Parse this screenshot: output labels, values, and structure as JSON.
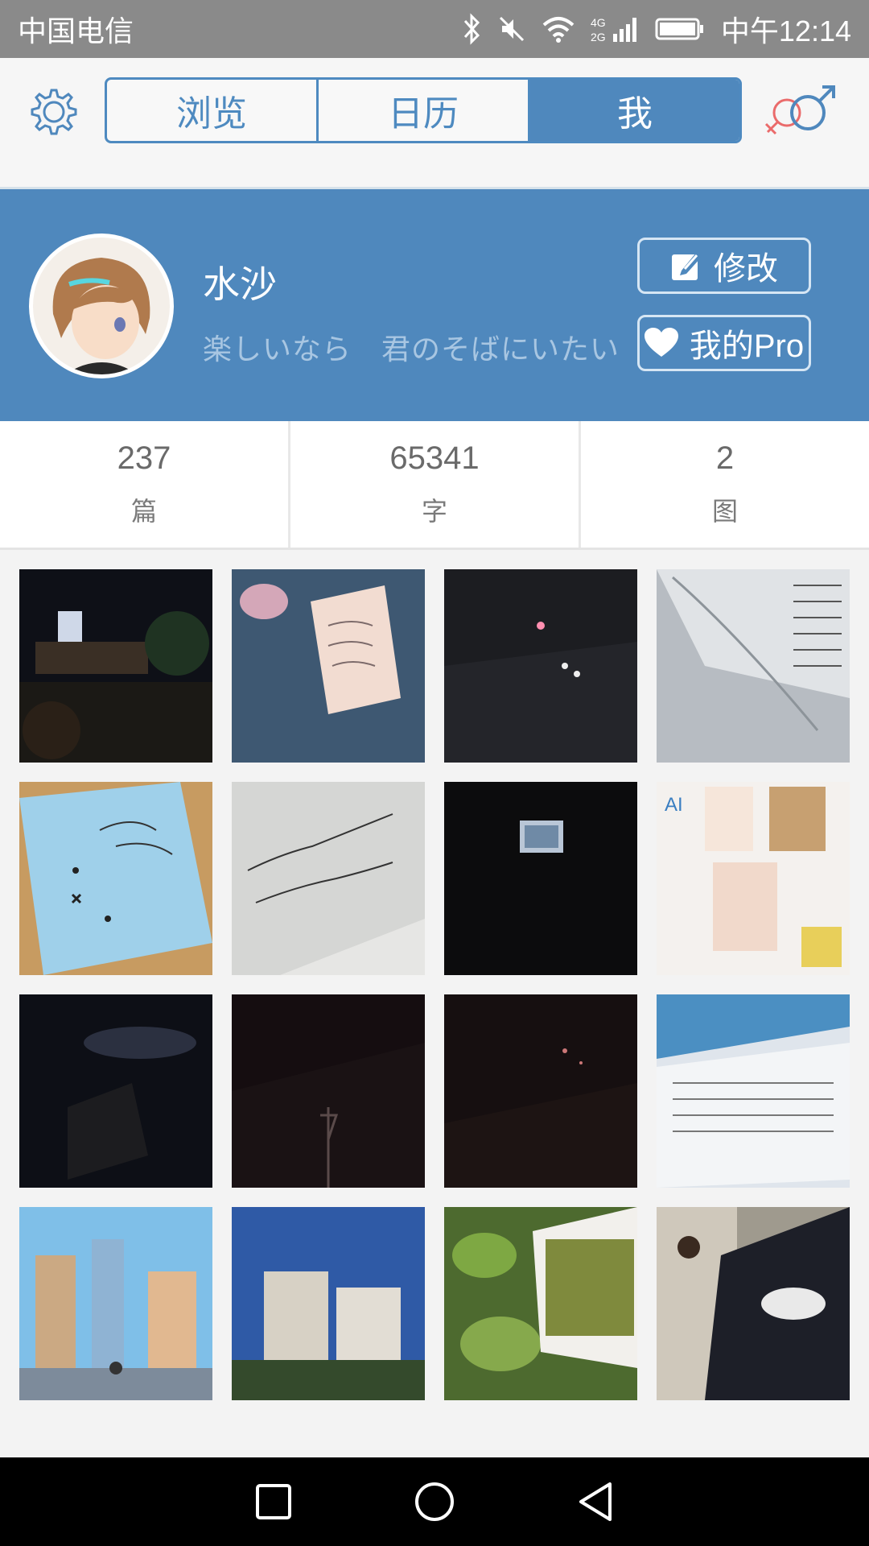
{
  "status_bar": {
    "carrier": "中国电信",
    "time": "中午12:14",
    "network": "4G"
  },
  "tabs": [
    {
      "label": "浏览",
      "active": false
    },
    {
      "label": "日历",
      "active": false
    },
    {
      "label": "我",
      "active": true
    }
  ],
  "profile": {
    "name": "水沙",
    "motto": "楽しいなら　君のそばにいたい",
    "edit_label": "修改",
    "pro_label": "我的Pro"
  },
  "stats": [
    {
      "value": "237",
      "label": "篇"
    },
    {
      "value": "65341",
      "label": "字"
    },
    {
      "value": "2",
      "label": "图"
    }
  ],
  "colors": {
    "accent": "#4f88bd",
    "status_bar": "#8a8a8a",
    "background": "#f3f3f3"
  },
  "icons": {
    "settings": "gear-icon",
    "gender": "gender-icon",
    "edit": "edit-icon",
    "pro": "heart-icon",
    "nav": [
      "square-icon",
      "circle-icon",
      "triangle-back-icon"
    ]
  }
}
